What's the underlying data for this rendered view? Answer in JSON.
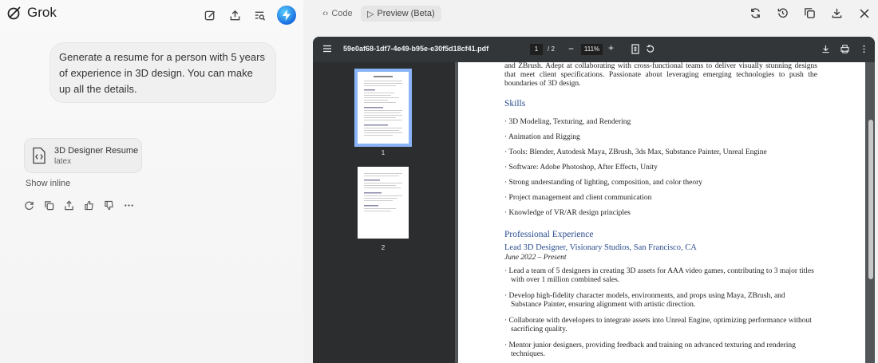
{
  "app": {
    "name": "Grok"
  },
  "chat": {
    "user_message": "Generate a resume for a person with 5 years of experience in 3D design. You can make up all the details.",
    "artifact": {
      "title": "3D Designer Resume",
      "subtitle": "latex"
    },
    "show_inline": "Show inline"
  },
  "preview": {
    "tab_code": "Code",
    "tab_preview": "Preview (Beta)"
  },
  "pdf": {
    "filename": "59e0af68-1df7-4e49-b95e-e30f5d18cf41.pdf",
    "current_page": "1",
    "total_pages": "/ 2",
    "zoom": "111%",
    "thumb_labels": [
      "1",
      "2"
    ]
  },
  "resume": {
    "summary": "and ZBrush. Adept at collaborating with cross-functional teams to deliver visually stunning designs that meet client specifications. Passionate about leveraging emerging technologies to push the boundaries of 3D design.",
    "skills_heading": "Skills",
    "skills": [
      "3D Modeling, Texturing, and Rendering",
      "Animation and Rigging",
      "Tools: Blender, Autodesk Maya, ZBrush, 3ds Max, Substance Painter, Unreal Engine",
      "Software: Adobe Photoshop, After Effects, Unity",
      "Strong understanding of lighting, composition, and color theory",
      "Project management and client communication",
      "Knowledge of VR/AR design principles"
    ],
    "experience_heading": "Professional Experience",
    "job_title": "Lead 3D Designer, Visionary Studios, San Francisco, CA",
    "job_dates": "June 2022 – Present",
    "job_bullets": [
      "Lead a team of 5 designers in creating 3D assets for AAA video games, contributing to 3 major titles with over 1 million combined sales.",
      "Develop high-fidelity character models, environments, and props using Maya, ZBrush, and Substance Painter, ensuring alignment with artistic direction.",
      "Collaborate with developers to integrate assets into Unreal Engine, optimizing performance without sacrificing quality.",
      "Mentor junior designers, providing feedback and training on advanced texturing and rendering techniques."
    ]
  }
}
